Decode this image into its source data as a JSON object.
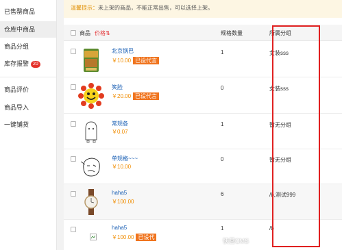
{
  "sidebar": {
    "items": [
      {
        "label": "已售罄商品"
      },
      {
        "label": "仓库中商品"
      },
      {
        "label": "商品分组"
      },
      {
        "label": "库存报警",
        "badge": "20"
      },
      {
        "label": "商品评价"
      },
      {
        "label": "商品导入"
      },
      {
        "label": "一键铺货"
      }
    ]
  },
  "tip": {
    "label": "温馨提示：",
    "text": "未上架的商品，不能正常出售，可以选择上架。"
  },
  "table": {
    "headers": {
      "product": "商品",
      "price": "价格⇅",
      "spec_count": "规格数量",
      "group": "所属分组"
    },
    "rows": [
      {
        "name": "北京锅巴",
        "price": "￥10.00",
        "tag": "已设代言",
        "spec": "1",
        "group": "女装sss",
        "image": "snack-bag-image"
      },
      {
        "name": "笑脸",
        "price": "￥20.00",
        "tag": "已设代言",
        "spec": "0",
        "group": "女装sss",
        "image": "smiley-sun-image"
      },
      {
        "name": "常规各",
        "price": "￥0.07",
        "tag": "",
        "spec": "1",
        "group": "暂无分组",
        "image": "sketch-figure-image"
      },
      {
        "name": "单规格~~~",
        "price": "￥10.00",
        "tag": "",
        "spec": "0",
        "group": "暂无分组",
        "image": "sketch-face-image"
      },
      {
        "name": "haha5",
        "price": "￥100.00",
        "tag": "",
        "spec": "6",
        "group": "/b,测试999",
        "image": "wristwatch-image"
      },
      {
        "name": "haha5",
        "price": "￥100.00",
        "tag": "已设代",
        "spec": "1",
        "group": "/b",
        "image": "broken-image-icon"
      }
    ]
  },
  "watermark": "快营CMS"
}
